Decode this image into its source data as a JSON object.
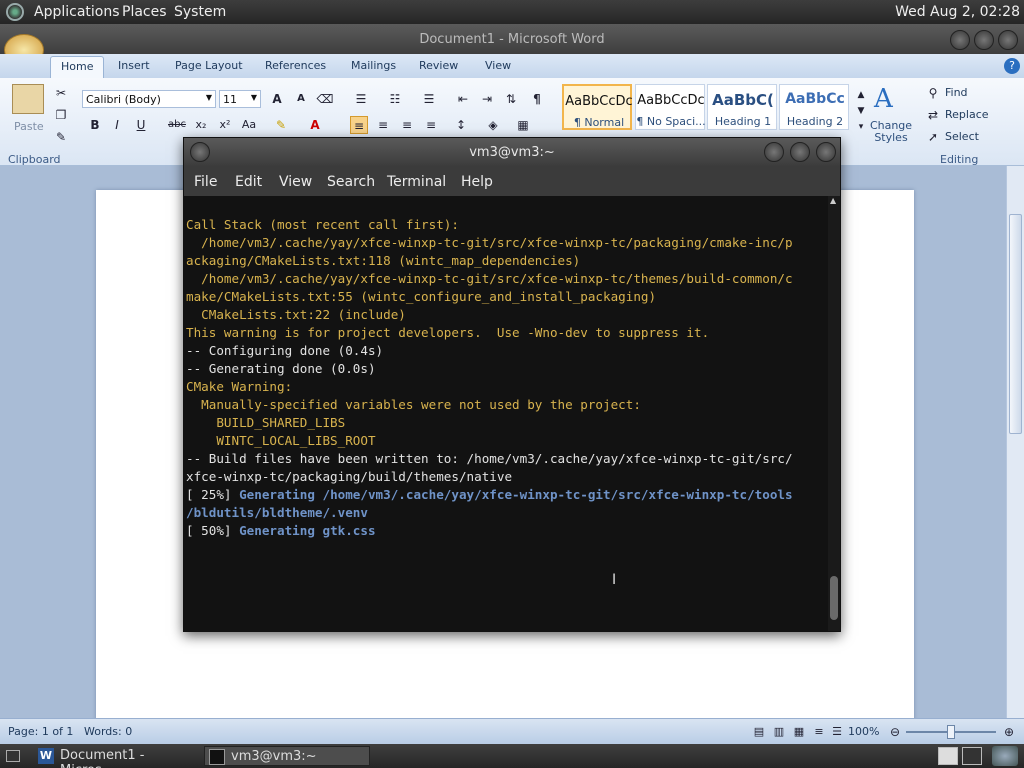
{
  "panel": {
    "applications": "Applications",
    "places": "Places",
    "system": "System",
    "clock": "Wed Aug  2, 02:28"
  },
  "word": {
    "title": "Document1 - Microsoft Word",
    "tabs": [
      "Home",
      "Insert",
      "Page Layout",
      "References",
      "Mailings",
      "Review",
      "View"
    ],
    "clipboard": {
      "paste": "Paste",
      "label": "Clipboard"
    },
    "font": {
      "name": "Calibri (Body)",
      "size": "11"
    },
    "styles": [
      {
        "sample": "AaBbCcDc",
        "name": "¶ Normal"
      },
      {
        "sample": "AaBbCcDc",
        "name": "¶ No Spaci..."
      },
      {
        "sample": "AaBbC(",
        "name": "Heading 1"
      },
      {
        "sample": "AaBbCc",
        "name": "Heading 2"
      }
    ],
    "change_styles": "Change Styles",
    "editing": {
      "find": "Find",
      "replace": "Replace",
      "select": "Select",
      "label": "Editing"
    },
    "status": {
      "page": "Page: 1 of 1",
      "words": "Words: 0",
      "zoom": "100%"
    }
  },
  "terminal": {
    "title": "vm3@vm3:~",
    "menu": [
      "File",
      "Edit",
      "View",
      "Search",
      "Terminal",
      "Help"
    ],
    "lines": [
      "Call Stack (most recent call first):",
      "  /home/vm3/.cache/yay/xfce-winxp-tc-git/src/xfce-winxp-tc/packaging/cmake-inc/p",
      "ackaging/CMakeLists.txt:118 (wintc_map_dependencies)",
      "  /home/vm3/.cache/yay/xfce-winxp-tc-git/src/xfce-winxp-tc/themes/build-common/c",
      "make/CMakeLists.txt:55 (wintc_configure_and_install_packaging)",
      "  CMakeLists.txt:22 (include)",
      "This warning is for project developers.  Use -Wno-dev to suppress it.",
      "",
      "-- Configuring done (0.4s)",
      "-- Generating done (0.0s)",
      "CMake Warning:",
      "  Manually-specified variables were not used by the project:",
      "",
      "    BUILD_SHARED_LIBS",
      "    WINTC_LOCAL_LIBS_ROOT",
      "",
      "",
      "-- Build files have been written to: /home/vm3/.cache/yay/xfce-winxp-tc-git/src/",
      "xfce-winxp-tc/packaging/build/themes/native",
      "[ 25%] ",
      "Generating /home/vm3/.cache/yay/xfce-winxp-tc-git/src/xfce-winxp-tc/tools",
      "/bldutils/bldtheme/.venv",
      "[ 50%] ",
      "Generating gtk.css"
    ]
  },
  "taskbar": {
    "items": [
      "Document1 - Micros...",
      "vm3@vm3:~"
    ]
  }
}
